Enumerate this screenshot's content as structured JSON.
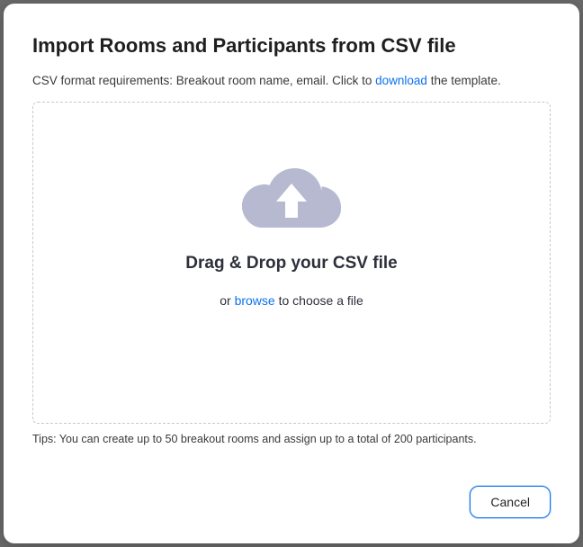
{
  "title": "Import Rooms and Participants from CSV file",
  "subtitle": {
    "pre": "CSV format requirements: Breakout room name, email. Click to ",
    "link": "download",
    "post": " the template."
  },
  "dropzone": {
    "title": "Drag & Drop your CSV file",
    "or": "or ",
    "browse": "browse",
    "rest": " to choose a file"
  },
  "tips": "Tips: You can create up to 50 breakout rooms and assign up to a total of 200 participants.",
  "buttons": {
    "cancel": "Cancel"
  },
  "colors": {
    "link": "#0e72ed",
    "icon": "#b7b9d1"
  }
}
